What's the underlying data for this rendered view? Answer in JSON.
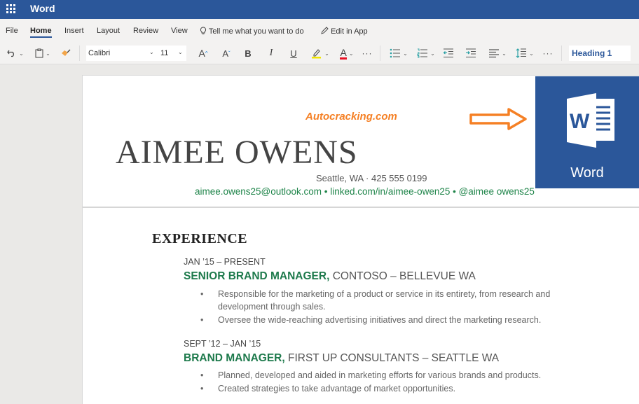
{
  "app": {
    "title": "Word",
    "menu_tabs": [
      "File",
      "Home",
      "Insert",
      "Layout",
      "Review",
      "View"
    ],
    "active_tab": "Home",
    "tell_me": "Tell me what you want to do",
    "edit_in_app": "Edit in App"
  },
  "toolbar": {
    "font_name": "Calibri",
    "font_size": "11",
    "bold": "B",
    "italic": "I",
    "underline": "U",
    "grow_font": "A",
    "shrink_font": "A",
    "font_color": "A",
    "more": "···",
    "style": "Heading 1",
    "colors": {
      "highlight": "#f2e600",
      "font_color": "#e81123",
      "accent": "#2b579a",
      "list_icons": "#2aa0a4"
    }
  },
  "overlay": {
    "watermark": "Autocracking.com",
    "tile_label": "Word",
    "arrow_color": "#f58025"
  },
  "document": {
    "name": "AIMEE OWENS",
    "location_phone": "Seattle, WA · 425 555 0199",
    "contacts": "aimee.owens25@outlook.com • linked.com/in/aimee-owen25 • @aimee owens25",
    "section_heading": "EXPERIENCE",
    "jobs": [
      {
        "dates": "JAN ’15 – PRESENT",
        "role": "SENIOR BRAND MANAGER,",
        "company": " CONTOSO – BELLEVUE WA",
        "bullets": [
          "Responsible for the marketing of a product or service in its entirety, from research and development through sales.",
          "Oversee the wide-reaching advertising initiatives and direct the marketing research."
        ]
      },
      {
        "dates": "SEPT ’12 – JAN ’15",
        "role": "BRAND MANAGER,",
        "company": " FIRST UP CONSULTANTS – SEATTLE WA",
        "bullets": [
          "Planned, developed and aided in marketing efforts for various brands and products.",
          "Created strategies to take advantage of market opportunities."
        ]
      }
    ],
    "bullet_glyph": "•"
  }
}
